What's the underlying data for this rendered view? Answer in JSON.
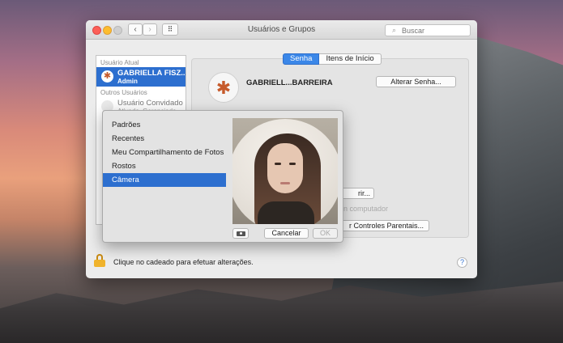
{
  "window": {
    "title": "Usuários e Grupos"
  },
  "search": {
    "placeholder": "Buscar"
  },
  "sidebar": {
    "current_header": "Usuário Atual",
    "current_user": {
      "name": "GABRIELLA FISZ...",
      "role": "Admin"
    },
    "other_header": "Outros Usuários",
    "other_user": {
      "name": "Usuário Convidado",
      "role": "Ativado, Gerenciado"
    }
  },
  "tabs": {
    "password": "Senha",
    "login_items": "Itens de Início"
  },
  "user": {
    "display_name": "GABRIELL...BARREIRA"
  },
  "buttons": {
    "change_password": "Alterar Senha...",
    "open_partial": "rir...",
    "parental_controls": "r Controles Parentais..."
  },
  "faded_text": "n computador",
  "footer": {
    "lock_text": "Clique no cadeado para efetuar alterações.",
    "help": "?"
  },
  "picker": {
    "menu": [
      "Padrões",
      "Recentes",
      "Meu Compartilhamento de Fotos",
      "Rostos",
      "Câmera"
    ],
    "selected_index": 4,
    "cancel": "Cancelar",
    "ok": "OK"
  }
}
